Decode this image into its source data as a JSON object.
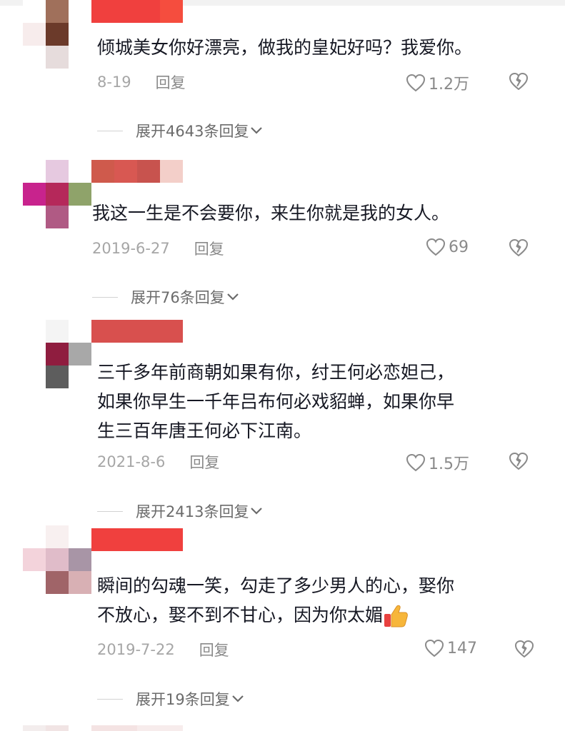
{
  "comments": [
    {
      "text_lines": [
        "倾城美女你好漂亮，做我的皇妃好吗？我爱你。"
      ],
      "date": "8-19",
      "reply_label": "回复",
      "likes": "1.2万",
      "expand_label": "展开4643条回复"
    },
    {
      "text_lines": [
        "我这一生是不会要你，来生你就是我的女人。"
      ],
      "date": "2019-6-27",
      "reply_label": "回复",
      "likes": "69",
      "expand_label": "展开76条回复"
    },
    {
      "text_lines": [
        "三千多年前商朝如果有你，纣王何必恋妲己，",
        "如果你早生一千年吕布何必戏貂蝉，如果你早",
        "生三百年唐王何必下江南。"
      ],
      "date": "2021-8-6",
      "reply_label": "回复",
      "likes": "1.5万",
      "expand_label": "展开2413条回复"
    },
    {
      "text_lines": [
        "瞬间的勾魂一笑，勾走了多少男人的心，娶你",
        "不放心，娶不到不甘心，因为你太媚"
      ],
      "date": "2019-7-22",
      "reply_label": "回复",
      "likes": "147",
      "expand_label": "展开19条回复"
    }
  ],
  "icons": {
    "like": "heart-outline-icon",
    "dislike": "broken-heart-icon",
    "expand": "chevron-down-icon",
    "emoji": "thumbs-up-icon"
  },
  "colors": {
    "text": "#161823",
    "meta": "#a6a6a6",
    "username_redaction": "#e8413f"
  }
}
